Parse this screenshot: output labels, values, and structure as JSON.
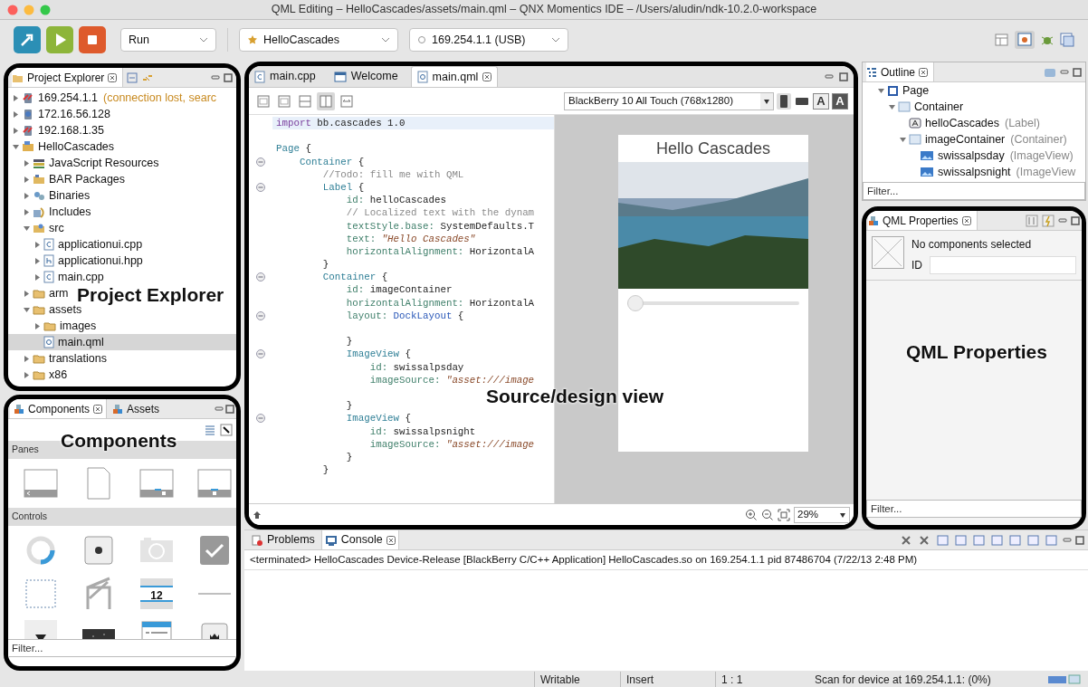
{
  "window": {
    "title": "QML Editing – HelloCascades/assets/main.qml – QNX Momentics IDE – /Users/aludin/ndk-10.2.0-workspace"
  },
  "toolbar": {
    "launch_mode": "Run",
    "project": "HelloCascades",
    "target": "169.254.1.1 (USB)"
  },
  "project_explorer": {
    "title": "Project Explorer",
    "callout": "Project Explorer",
    "tree": [
      {
        "label": "169.254.1.1",
        "note": "(connection lost, searc",
        "kind": "target-error",
        "expanded": false,
        "selected": false
      },
      {
        "label": "172.16.56.128",
        "kind": "target",
        "expanded": false,
        "selected": false
      },
      {
        "label": "192.168.1.35",
        "kind": "target-error",
        "expanded": false,
        "selected": false
      },
      {
        "label": "HelloCascades",
        "kind": "project",
        "expanded": true,
        "selected": false,
        "children": [
          {
            "label": "JavaScript Resources",
            "kind": "js",
            "expanded": false,
            "selected": false
          },
          {
            "label": "BAR Packages",
            "kind": "bar",
            "expanded": false,
            "selected": false
          },
          {
            "label": "Binaries",
            "kind": "binaries",
            "expanded": false,
            "selected": false
          },
          {
            "label": "Includes",
            "kind": "includes",
            "expanded": false,
            "selected": false
          },
          {
            "label": "src",
            "kind": "src",
            "expanded": true,
            "selected": false,
            "children": [
              {
                "label": "applicationui.cpp",
                "kind": "file-c",
                "expanded": false,
                "selected": false
              },
              {
                "label": "applicationui.hpp",
                "kind": "file-h",
                "expanded": false,
                "selected": false
              },
              {
                "label": "main.cpp",
                "kind": "file-c",
                "expanded": false,
                "selected": false
              }
            ]
          },
          {
            "label": "arm",
            "kind": "folder",
            "expanded": false,
            "selected": false
          },
          {
            "label": "assets",
            "kind": "folder",
            "expanded": true,
            "selected": false,
            "children": [
              {
                "label": "images",
                "kind": "folder",
                "expanded": false,
                "selected": false
              },
              {
                "label": "main.qml",
                "kind": "file-qml",
                "selected": true
              }
            ]
          },
          {
            "label": "translations",
            "kind": "folder",
            "expanded": false,
            "selected": false
          },
          {
            "label": "x86",
            "kind": "folder",
            "expanded": false,
            "selected": false
          }
        ]
      }
    ]
  },
  "components": {
    "callout": "Components",
    "tabs": [
      {
        "label": "Components",
        "selected": true
      },
      {
        "label": "Assets",
        "selected": false
      }
    ],
    "sections": [
      {
        "label": "Panes",
        "items": [
          {
            "kind": "navigation"
          },
          {
            "kind": "page"
          },
          {
            "kind": "tabbed"
          },
          {
            "kind": "sheet"
          }
        ]
      },
      {
        "label": "Controls",
        "items": [
          {
            "kind": "activity"
          },
          {
            "kind": "button"
          },
          {
            "kind": "camera"
          },
          {
            "kind": "checkbox"
          },
          {
            "kind": "container"
          },
          {
            "kind": "custom"
          },
          {
            "kind": "date",
            "text": "12"
          },
          {
            "kind": "divider"
          },
          {
            "kind": "dropdown"
          },
          {
            "kind": "image"
          },
          {
            "kind": "list"
          },
          {
            "kind": "toggle"
          }
        ]
      }
    ],
    "filter": {
      "placeholder": "Filter..."
    }
  },
  "editor": {
    "callout": "Source/design view",
    "tabs": [
      {
        "label": "main.cpp",
        "kind": "file-c",
        "selected": false,
        "closable": false
      },
      {
        "label": "Welcome",
        "kind": "window",
        "selected": false,
        "closable": false
      },
      {
        "label": "main.qml",
        "kind": "file-qml",
        "selected": true,
        "closable": true
      }
    ],
    "view_buttons": [
      {
        "selected": false
      },
      {
        "selected": false
      },
      {
        "selected": false
      },
      {
        "selected": true
      },
      {
        "selected": false
      }
    ],
    "device": "BlackBerry 10 All Touch (768x1280)",
    "theme_buttons": [
      {
        "label": "A",
        "kind": "light"
      },
      {
        "label": "A",
        "kind": "dark"
      }
    ],
    "code": [
      {
        "kind": "code",
        "current": true,
        "segments": [
          {
            "kind": "keyword",
            "text": "import"
          },
          {
            "kind": "plain",
            "text": " bb.cascades 1.0"
          }
        ]
      },
      {
        "kind": "blank"
      },
      {
        "kind": "code",
        "segments": [
          {
            "kind": "type",
            "text": "Page"
          },
          {
            "kind": "plain",
            "text": " {"
          }
        ]
      },
      {
        "kind": "code",
        "fold": true,
        "segments": [
          {
            "kind": "type",
            "text": "    Container"
          },
          {
            "kind": "plain",
            "text": " {"
          }
        ]
      },
      {
        "kind": "code",
        "segments": [
          {
            "kind": "comment",
            "text": "        //Todo: fill me with QML"
          }
        ]
      },
      {
        "kind": "code",
        "fold": true,
        "segments": [
          {
            "kind": "type",
            "text": "        Label"
          },
          {
            "kind": "plain",
            "text": " {"
          }
        ]
      },
      {
        "kind": "code",
        "segments": [
          {
            "kind": "property",
            "text": "            id:"
          },
          {
            "kind": "plain",
            "text": " helloCascades"
          }
        ]
      },
      {
        "kind": "code",
        "segments": [
          {
            "kind": "comment",
            "text": "            // Localized text with the dynam"
          }
        ]
      },
      {
        "kind": "code",
        "segments": [
          {
            "kind": "property",
            "text": "            textStyle.base:"
          },
          {
            "kind": "plain",
            "text": " SystemDefaults.T"
          }
        ]
      },
      {
        "kind": "code",
        "segments": [
          {
            "kind": "property",
            "text": "            text: "
          },
          {
            "kind": "string",
            "text": "\"Hello Cascades\""
          }
        ]
      },
      {
        "kind": "code",
        "segments": [
          {
            "kind": "property",
            "text": "            horizontalAlignment:"
          },
          {
            "kind": "plain",
            "text": " HorizontalA"
          }
        ]
      },
      {
        "kind": "code",
        "segments": [
          {
            "kind": "plain",
            "text": "        }"
          }
        ]
      },
      {
        "kind": "code",
        "fold": true,
        "segments": [
          {
            "kind": "type",
            "text": "        Container"
          },
          {
            "kind": "plain",
            "text": " {"
          }
        ]
      },
      {
        "kind": "code",
        "segments": [
          {
            "kind": "property",
            "text": "            id:"
          },
          {
            "kind": "plain",
            "text": " imageContainer"
          }
        ]
      },
      {
        "kind": "code",
        "segments": [
          {
            "kind": "property",
            "text": "            horizontalAlignment:"
          },
          {
            "kind": "plain",
            "text": " HorizontalA"
          }
        ]
      },
      {
        "kind": "code",
        "fold": true,
        "segments": [
          {
            "kind": "property",
            "text": "            layout: "
          },
          {
            "kind": "ref",
            "text": "DockLayout"
          },
          {
            "kind": "plain",
            "text": " {"
          }
        ]
      },
      {
        "kind": "blank"
      },
      {
        "kind": "code",
        "segments": [
          {
            "kind": "plain",
            "text": "            }"
          }
        ]
      },
      {
        "kind": "code",
        "fold": true,
        "segments": [
          {
            "kind": "type",
            "text": "            ImageView"
          },
          {
            "kind": "plain",
            "text": " {"
          }
        ]
      },
      {
        "kind": "code",
        "segments": [
          {
            "kind": "property",
            "text": "                id:"
          },
          {
            "kind": "plain",
            "text": " swissalpsday"
          }
        ]
      },
      {
        "kind": "code",
        "segments": [
          {
            "kind": "property",
            "text": "                imageSource: "
          },
          {
            "kind": "string",
            "text": "\"asset:///image"
          }
        ]
      },
      {
        "kind": "blank"
      },
      {
        "kind": "code",
        "segments": [
          {
            "kind": "plain",
            "text": "            }"
          }
        ]
      },
      {
        "kind": "code",
        "fold": true,
        "segments": [
          {
            "kind": "type",
            "text": "            ImageView"
          },
          {
            "kind": "plain",
            "text": " {"
          }
        ]
      },
      {
        "kind": "code",
        "segments": [
          {
            "kind": "property",
            "text": "                id:"
          },
          {
            "kind": "plain",
            "text": " swissalpsnight"
          }
        ]
      },
      {
        "kind": "code",
        "segments": [
          {
            "kind": "property",
            "text": "                imageSource: "
          },
          {
            "kind": "string",
            "text": "\"asset:///image"
          }
        ]
      },
      {
        "kind": "code",
        "segments": [
          {
            "kind": "plain",
            "text": "            }"
          }
        ]
      },
      {
        "kind": "code",
        "segments": [
          {
            "kind": "plain",
            "text": "        }"
          }
        ]
      }
    ],
    "preview": {
      "title": "Hello Cascades",
      "slider": {
        "level": 0
      }
    },
    "zoom": "29%"
  },
  "outline": {
    "title": "Outline",
    "tree": [
      {
        "label": "Page",
        "kind": "page",
        "expanded": true,
        "selected": false,
        "children": [
          {
            "label": "Container",
            "kind": "container",
            "expanded": true,
            "selected": false,
            "children": [
              {
                "label": "helloCascades",
                "type": "(Label)",
                "kind": "label",
                "selected": false
              },
              {
                "label": "imageContainer",
                "type": "(Container)",
                "kind": "container",
                "expanded": true,
                "selected": false,
                "children": [
                  {
                    "label": "swissalpsday",
                    "type": "(ImageView)",
                    "kind": "image",
                    "selected": false
                  },
                  {
                    "label": "swissalpsnight",
                    "type": "(ImageView",
                    "kind": "image",
                    "selected": false
                  }
                ]
              }
            ]
          }
        ]
      }
    ],
    "filter": {
      "placeholder": "Filter..."
    }
  },
  "properties": {
    "title": "QML Properties",
    "callout": "QML Properties",
    "message": "No components selected",
    "id_label": "ID",
    "filter": {
      "placeholder": "Filter..."
    }
  },
  "console": {
    "tabs": [
      {
        "label": "Problems",
        "kind": "problems",
        "selected": false,
        "closable": false
      },
      {
        "label": "Console",
        "kind": "console",
        "selected": true,
        "closable": true
      }
    ],
    "lines": [
      "<terminated> HelloCascades Device-Release [BlackBerry C/C++ Application] HelloCascades.so on 169.254.1.1 pid 87486704 (7/22/13 2:48 PM)"
    ]
  },
  "status_bar": {
    "mode": "Writable",
    "insert": "Insert",
    "position": "1 : 1",
    "progress": "Scan for device at 169.254.1.1: (0%)"
  }
}
